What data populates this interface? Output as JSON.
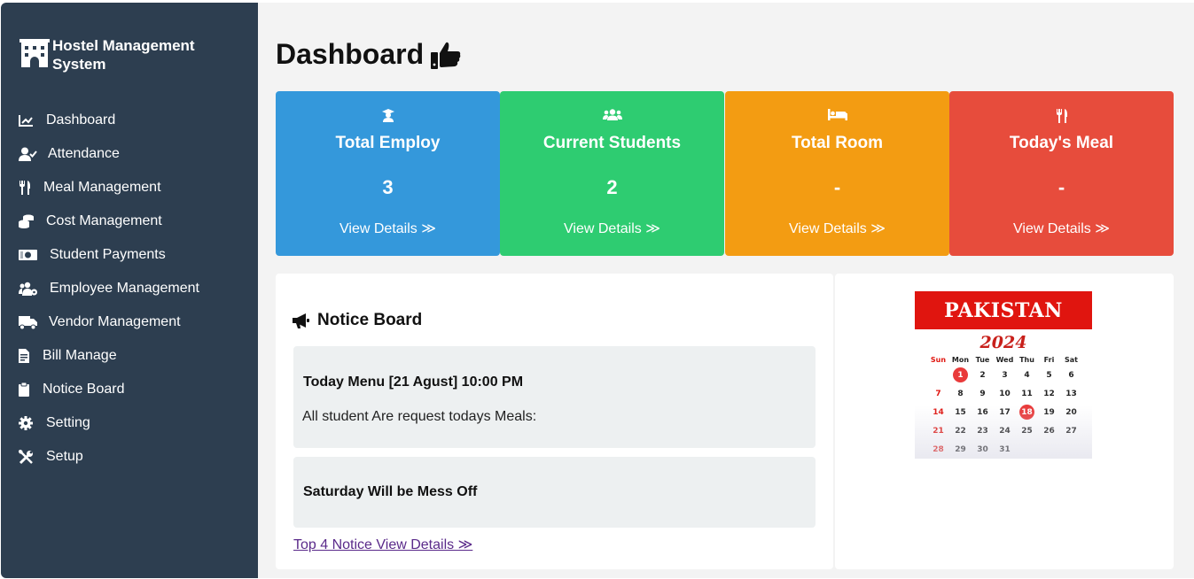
{
  "app": {
    "title": "Hostel Management System"
  },
  "sidebar": {
    "items": [
      {
        "label": "Dashboard",
        "icon": "chart-line-icon"
      },
      {
        "label": "Attendance",
        "icon": "user-check-icon"
      },
      {
        "label": "Meal Management",
        "icon": "utensils-icon"
      },
      {
        "label": "Cost Management",
        "icon": "coins-icon"
      },
      {
        "label": "Student Payments",
        "icon": "money-bill-icon"
      },
      {
        "label": "Employee Management",
        "icon": "users-cog-icon"
      },
      {
        "label": "Vendor Management",
        "icon": "truck-icon"
      },
      {
        "label": "Bill Manage",
        "icon": "file-invoice-icon"
      },
      {
        "label": "Notice Board",
        "icon": "clipboard-icon"
      },
      {
        "label": "Setting",
        "icon": "gear-icon"
      },
      {
        "label": "Setup",
        "icon": "tools-icon"
      }
    ]
  },
  "page": {
    "title": "Dashboard"
  },
  "cards": [
    {
      "title": "Total Employ",
      "value": "3",
      "link": "View Details ≫",
      "color": "#3498db",
      "icon": "graduate-icon"
    },
    {
      "title": "Current Students",
      "value": "2",
      "link": "View Details ≫",
      "color": "#2ecc71",
      "icon": "users-icon"
    },
    {
      "title": "Total Room",
      "value": "-",
      "link": "View Details ≫",
      "color": "#f39c12",
      "icon": "bed-icon"
    },
    {
      "title": "Today's Meal",
      "value": "-",
      "link": "View Details ≫",
      "color": "#e74c3c",
      "icon": "utensils-icon"
    }
  ],
  "notice_board": {
    "title": "Notice Board",
    "items": [
      {
        "title": "Today Menu [21 Agust] 10:00 PM",
        "body": "All student Are request todays Meals:"
      },
      {
        "title": "Saturday Will be Mess Off",
        "body": ""
      }
    ],
    "link": "Top 4 Notice View Details ≫"
  },
  "calendar": {
    "country": "PAKISTAN",
    "year": "2024",
    "weekdays": [
      "Sun",
      "Mon",
      "Tue",
      "Wed",
      "Thu",
      "Fri",
      "Sat"
    ],
    "days": [
      "1",
      "2",
      "3",
      "4",
      "5",
      "6",
      "7",
      "8",
      "9",
      "10",
      "11",
      "12",
      "13",
      "14",
      "15",
      "16",
      "17",
      "18",
      "19",
      "20",
      "21",
      "22",
      "23",
      "24",
      "25",
      "26",
      "27",
      "28",
      "29",
      "30",
      "31"
    ],
    "highlighted": [
      "1",
      "18"
    ]
  }
}
